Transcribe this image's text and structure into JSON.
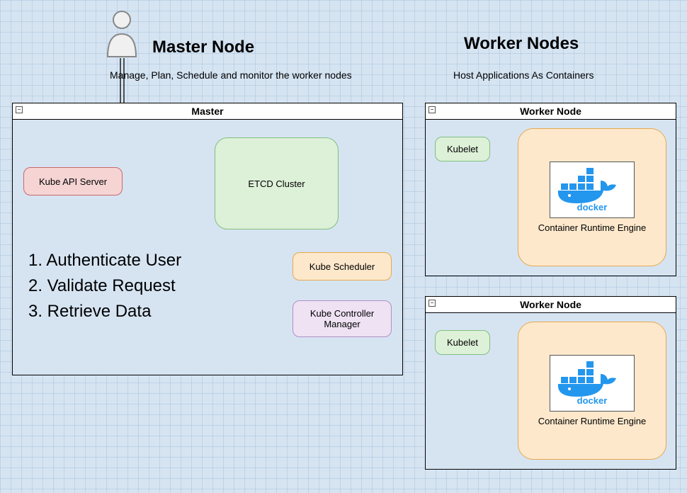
{
  "titles": {
    "master": "Master Node",
    "master_sub": "Manage, Plan, Schedule and monitor the worker nodes",
    "worker": "Worker Nodes",
    "worker_sub": "Host Applications As Containers"
  },
  "master_panel": {
    "header": "Master"
  },
  "worker_panel": {
    "header": "Worker Node"
  },
  "components": {
    "api_server": "Kube API Server",
    "etcd": "ETCD Cluster",
    "scheduler": "Kube Scheduler",
    "controller": "Kube Controller Manager",
    "kubelet": "Kubelet",
    "runtime": "Container Runtime Engine",
    "docker": "docker"
  },
  "steps": {
    "s1": "1. Authenticate User",
    "s2": "2. Validate Request",
    "s3": "3. Retrieve Data"
  },
  "collapse_glyph": "−"
}
